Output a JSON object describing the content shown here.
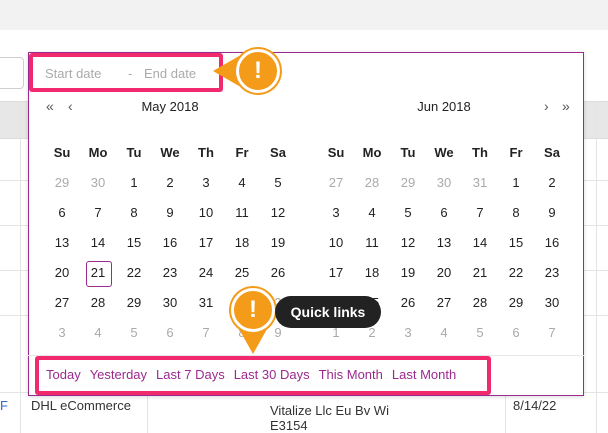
{
  "range": {
    "start_placeholder": "Start date",
    "separator": "-",
    "end_placeholder": "End date"
  },
  "weekdays": [
    "Su",
    "Mo",
    "Tu",
    "We",
    "Th",
    "Fr",
    "Sa"
  ],
  "months": [
    {
      "title": "May 2018",
      "rows": [
        [
          "29",
          "30",
          "1",
          "2",
          "3",
          "4",
          "5"
        ],
        [
          "6",
          "7",
          "8",
          "9",
          "10",
          "11",
          "12"
        ],
        [
          "13",
          "14",
          "15",
          "16",
          "17",
          "18",
          "19"
        ],
        [
          "20",
          "21",
          "22",
          "23",
          "24",
          "25",
          "26"
        ],
        [
          "27",
          "28",
          "29",
          "30",
          "31",
          "1",
          "2"
        ],
        [
          "3",
          "4",
          "5",
          "6",
          "7",
          "8",
          "9"
        ]
      ]
    },
    {
      "title": "Jun 2018",
      "rows": [
        [
          "27",
          "28",
          "29",
          "30",
          "31",
          "1",
          "2"
        ],
        [
          "3",
          "4",
          "5",
          "6",
          "7",
          "8",
          "9"
        ],
        [
          "10",
          "11",
          "12",
          "13",
          "14",
          "15",
          "16"
        ],
        [
          "17",
          "18",
          "19",
          "20",
          "21",
          "22",
          "23"
        ],
        [
          "24",
          "25",
          "26",
          "27",
          "28",
          "29",
          "30"
        ],
        [
          "1",
          "2",
          "3",
          "4",
          "5",
          "6",
          "7"
        ]
      ]
    }
  ],
  "nav": {
    "prev_year": "«",
    "prev_month": "‹",
    "next_month": "›",
    "next_year": "»"
  },
  "quick_links": [
    "Today",
    "Yesterday",
    "Last 7 Days",
    "Last 30 Days",
    "This Month",
    "Last Month"
  ],
  "callouts": {
    "badge_symbol": "!",
    "tooltip": "Quick links"
  },
  "background": {
    "row_carrier": "DHL eCommerce",
    "row_company_line1": "Vitalize Llc Eu Bv Wi",
    "row_company_line2": "E3154",
    "row_date": "8/14/22"
  },
  "colors": {
    "accent": "#9b2a8e",
    "highlight": "#f1296f",
    "callout": "#f49b1a"
  }
}
